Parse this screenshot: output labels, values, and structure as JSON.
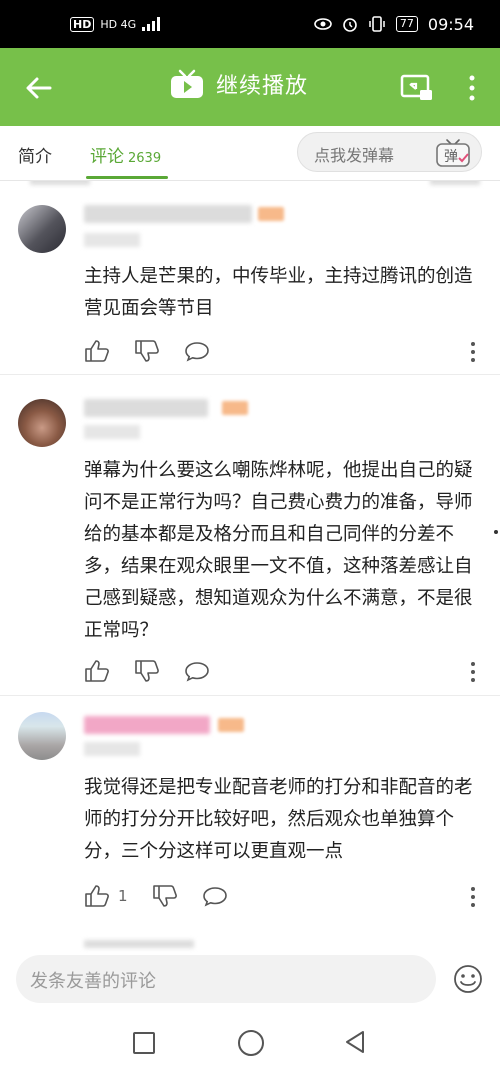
{
  "status_bar": {
    "left": "HD 4G",
    "battery": "77",
    "time": "09:54"
  },
  "app_bar": {
    "title": "继续播放",
    "icons": [
      "back-arrow-icon",
      "tv-play-icon",
      "cast-screen-icon",
      "more-vertical-icon"
    ]
  },
  "tabs": {
    "intro": "简介",
    "comments": "评论",
    "comments_count": "2639"
  },
  "danmu": {
    "placeholder": "点我发弹幕",
    "icon_label": "弹"
  },
  "comments": [
    {
      "text": "主持人是芒果的，中传毕业，主持过腾讯的创造营见面会等节目",
      "likes": "",
      "avatar_color": "#54545c"
    },
    {
      "text": "弹幕为什么要这么嘲陈烨林呢，他提出自己的疑问不是正常行为吗？自己费心费力的准备，导师给的基本都是及格分而且和自己同伴的分差不多，结果在观众眼里一文不值，这种落差感让自己感到疑惑，想知道观众为什么不满意，不是很正常吗？",
      "likes": "",
      "avatar_color": "#7a4a38"
    },
    {
      "text": "我觉得还是把专业配音老师的打分和非配音的老师的打分分开比较好吧，然后观众也单独算个分，三个分这样可以更直观一点",
      "likes": "1",
      "avatar_color": "#b7c2c6",
      "name_color": "#f2a7c6"
    }
  ],
  "bottom": {
    "placeholder": "发条友善的评论"
  },
  "colors": {
    "accent": "#77c04a",
    "tab_active": "#5aa836",
    "level_badge": "#f7b98a"
  }
}
